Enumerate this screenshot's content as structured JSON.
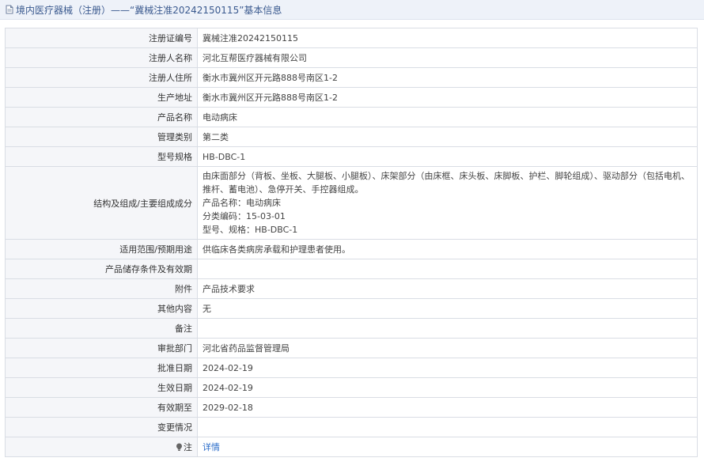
{
  "header": {
    "title": "境内医疗器械（注册）——“冀械注准20242150115”基本信息"
  },
  "rows": [
    {
      "label": "注册证编号",
      "value": "冀械注准20242150115"
    },
    {
      "label": "注册人名称",
      "value": "河北互帮医疗器械有限公司"
    },
    {
      "label": "注册人住所",
      "value": "衡水市冀州区开元路888号南区1-2"
    },
    {
      "label": "生产地址",
      "value": "衡水市冀州区开元路888号南区1-2"
    },
    {
      "label": "产品名称",
      "value": "电动病床"
    },
    {
      "label": "管理类别",
      "value": "第二类"
    },
    {
      "label": "型号规格",
      "value": "HB-DBC-1"
    },
    {
      "label": "结构及组成/主要组成成分",
      "lines": [
        "由床面部分（背板、坐板、大腿板、小腿板）、床架部分（由床框、床头板、床脚板、护栏、脚轮组成）、驱动部分（包括电机、推杆、蓄电池）、急停开关、手控器组成。",
        "产品名称：电动病床",
        "分类编码：15-03-01",
        "型号、规格：HB-DBC-1"
      ]
    },
    {
      "label": "适用范围/预期用途",
      "value": "供临床各类病房承载和护理患者使用。"
    },
    {
      "label": "产品储存条件及有效期",
      "value": ""
    },
    {
      "label": "附件",
      "value": "产品技术要求"
    },
    {
      "label": "其他内容",
      "value": "无"
    },
    {
      "label": "备注",
      "value": ""
    },
    {
      "label": "审批部门",
      "value": "河北省药品监督管理局"
    },
    {
      "label": "批准日期",
      "value": "2024-02-19"
    },
    {
      "label": "生效日期",
      "value": "2024-02-19"
    },
    {
      "label": "有效期至",
      "value": "2029-02-18"
    },
    {
      "label": "变更情况",
      "value": ""
    }
  ],
  "note_row": {
    "label": "注",
    "link_text": "详情",
    "icon": "lightbulb-icon"
  },
  "colors": {
    "header_bg": "#eef2f9",
    "title": "#3b5a8f",
    "link": "#2a6cc9",
    "label_bg": "#f5f6f9",
    "border": "#d9dde4"
  }
}
